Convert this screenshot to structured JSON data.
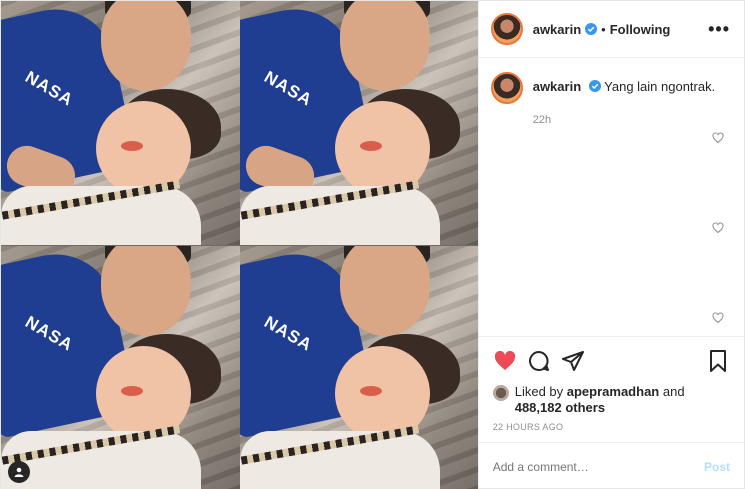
{
  "header": {
    "username": "awkarin",
    "separator": "•",
    "follow_label": "Following",
    "more_label": "•••"
  },
  "caption": {
    "username": "awkarin",
    "text": "Yang lain ngontrak.",
    "time": "22h"
  },
  "media": {
    "shirt_text": "NASA"
  },
  "likes": {
    "prefix": "Liked by",
    "user": "apepramadhan",
    "conj": "and",
    "others": "488,182 others"
  },
  "timestamp": "22 HOURS AGO",
  "add_comment": {
    "placeholder": "Add a comment…",
    "post_label": "Post"
  },
  "colors": {
    "like_red": "#ed4956",
    "verified_blue": "#3897f0",
    "post_button": "#b2dffc"
  },
  "icons": [
    "heart-icon",
    "comment-icon",
    "share-icon",
    "bookmark-icon",
    "verified-icon",
    "user-tag-icon",
    "more-icon"
  ]
}
